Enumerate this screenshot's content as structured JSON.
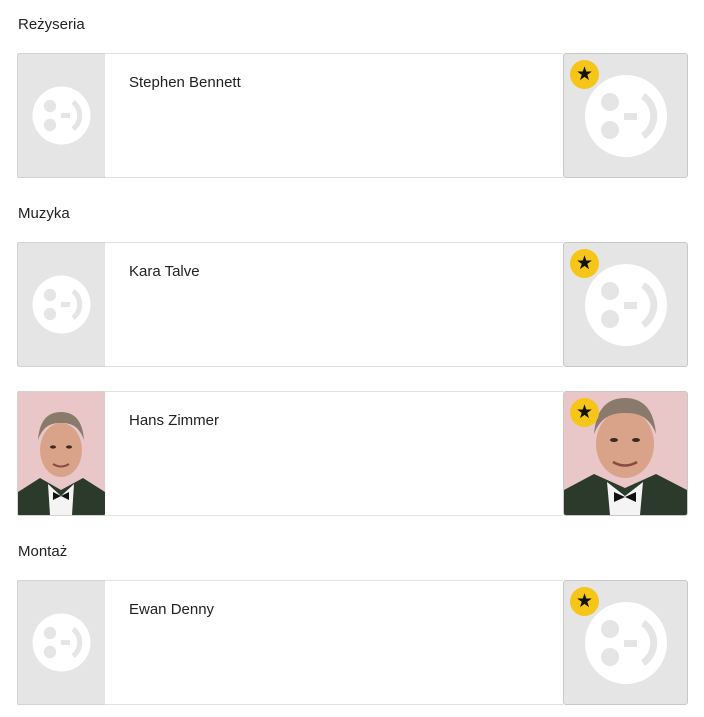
{
  "sections": [
    {
      "title": "Reżyseria",
      "people": [
        {
          "name": "Stephen Bennett",
          "has_photo": false
        }
      ]
    },
    {
      "title": "Muzyka",
      "people": [
        {
          "name": "Kara Talve",
          "has_photo": false
        },
        {
          "name": "Hans Zimmer",
          "has_photo": true
        }
      ]
    },
    {
      "title": "Montaż",
      "people": [
        {
          "name": "Ewan Denny",
          "has_photo": false
        }
      ]
    }
  ],
  "icons": {
    "placeholder": "film-reel-placeholder-icon",
    "badge": "star-icon"
  },
  "colors": {
    "badge_bg": "#f5c518",
    "placeholder_bg": "#e5e5e5",
    "placeholder_icon": "#ffffff"
  }
}
